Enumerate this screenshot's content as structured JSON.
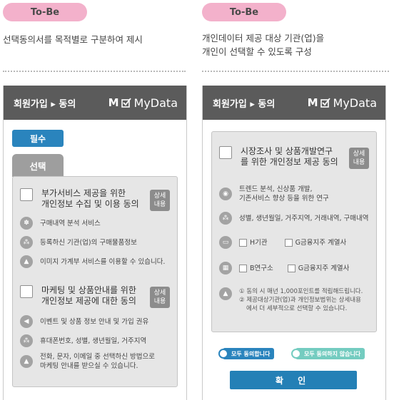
{
  "left": {
    "badge": "To-Be",
    "description": "선택동의서를 목적별로 구분하여 제시",
    "header_title": "회원가입 ▸ 동의",
    "logo_text": "MyData",
    "logo_mark": "M",
    "required_label": "필수",
    "optional_tab": "선택",
    "sections": [
      {
        "title_line1": "부가서비스 제공을 위한",
        "title_line2": "개인정보 수집 및 이용 동의",
        "detail_line1": "상세",
        "detail_line2": "내용",
        "items": [
          {
            "icon": "service-icon",
            "text": "구매내역 분석 서비스"
          },
          {
            "icon": "link-icon",
            "text": "등록하신 기관(업)의 구매물품정보"
          },
          {
            "icon": "warning-icon",
            "text": "이미지 가계부 서비스를 이용할 수 있습니다."
          }
        ]
      },
      {
        "title_line1": "마케팅 및 상품안내를 위한",
        "title_line2": "개인정보 제공에 대한 동의",
        "detail_line1": "상세",
        "detail_line2": "내용",
        "items": [
          {
            "icon": "megaphone-icon",
            "text": "이벤트 및 상품 정보 안내 및 가입 권유"
          },
          {
            "icon": "link-icon",
            "text": "휴대폰번호, 성별, 생년월일, 거주지역"
          },
          {
            "icon": "warning-icon",
            "text_line1": "전화, 문자, 이메일 중 선택하신 방법으로",
            "text_line2": "마케팅 안내를 받으실 수 있습니다."
          }
        ]
      }
    ]
  },
  "right": {
    "badge": "To-Be",
    "description_line1": "개인데이터 제공 대상 기관(업)을",
    "description_line2": "개인이 선택할 수 있도록 구성",
    "header_title": "회원가입 ▸ 동의",
    "logo_text": "MyData",
    "logo_mark": "M",
    "section": {
      "title_line1": "시장조사 및 상품개발연구",
      "title_line2": "를 위한 개인정보 제공 동의",
      "detail_line1": "상세",
      "detail_line2": "내용",
      "purpose_line1": "트렌드 분석, 신상품 개발,",
      "purpose_line2": "기존서비스 향상 등을 위한 연구",
      "data_items": "성별, 생년월일, 거주지역, 거래내역, 구매내역",
      "orgs": [
        {
          "icon": "bank-icon",
          "options": [
            "H기관",
            "G금융지주 계열사"
          ]
        },
        {
          "icon": "building-icon",
          "options": [
            "B연구소",
            "G금융지주 계열사"
          ]
        }
      ],
      "note_line1": "① 동의 시 매년 1,000포인트를 적립해드립니다.",
      "note_line2": "② 제공대상기관(업)과 개인정보범위는 상세내용",
      "note_line3": "에서 더 세부적으로 선택할 수 있습니다."
    },
    "agree_all": "모두 동의합니다",
    "disagree_all": "모두 동의하지 않습니다",
    "confirm": "확 인"
  },
  "colors": {
    "badge_pink": "#f3b1cb",
    "header_gray": "#5b5b5b",
    "accent_blue": "#2480b6",
    "required_blue": "#2a84bd",
    "mint": "#74ccc0",
    "panel_gray": "#e6e6e6"
  }
}
